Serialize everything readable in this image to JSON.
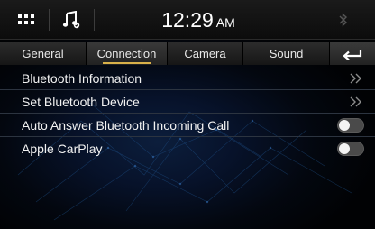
{
  "status_bar": {
    "menu_icon": "grid-icon",
    "source_icon": "music-note-icon",
    "time": "12:29",
    "ampm": "AM",
    "bluetooth_icon": "bluetooth-icon"
  },
  "tabs": [
    {
      "label": "General",
      "active": false
    },
    {
      "label": "Connection",
      "active": true
    },
    {
      "label": "Camera",
      "active": false
    },
    {
      "label": "Sound",
      "active": false
    }
  ],
  "back_icon": "back-arrow-icon",
  "settings": [
    {
      "label": "Bluetooth Information",
      "control": "chevron"
    },
    {
      "label": "Set Bluetooth Device",
      "control": "chevron"
    },
    {
      "label": "Auto Answer Bluetooth Incoming Call",
      "control": "toggle",
      "on": false
    },
    {
      "label": "Apple CarPlay",
      "control": "toggle",
      "on": false
    }
  ],
  "colors": {
    "accent": "#d9b14a",
    "background": "#03070f"
  }
}
